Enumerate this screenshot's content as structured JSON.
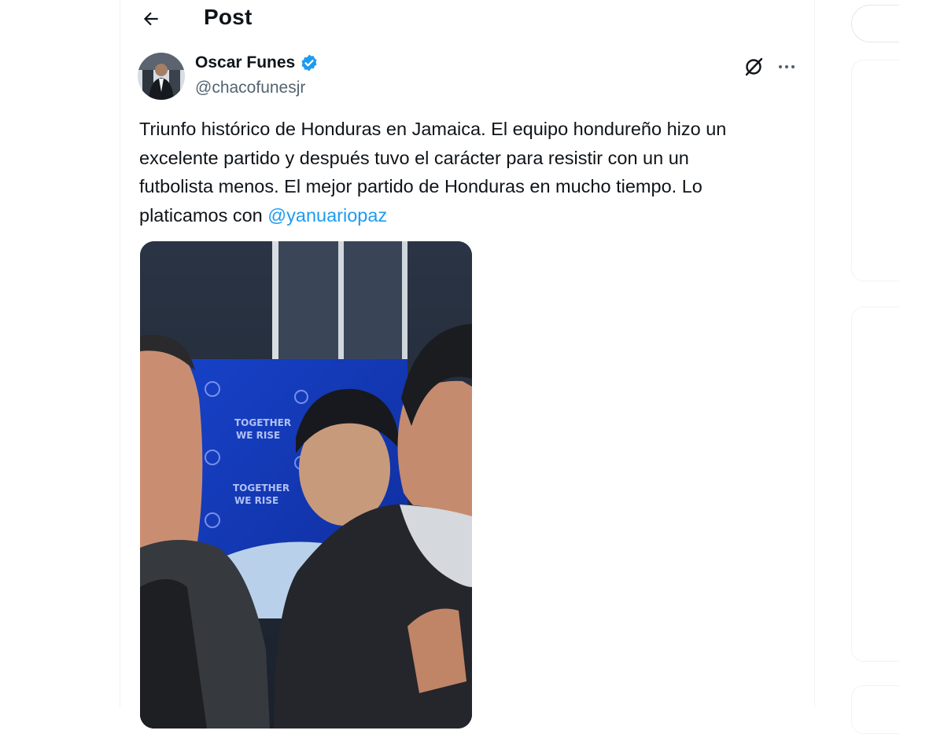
{
  "header": {
    "title": "Post"
  },
  "post": {
    "author_name": "Oscar Funes",
    "handle": "@chacofunesjr",
    "text_lines": [
      "Triunfo histórico de Honduras en Jamaica. El equipo hondureño hizo un",
      "excelente partido y después tuvo el carácter para resistir con un un",
      "futbolista menos. El mejor partido de Honduras en mucho tiempo. Lo",
      "platicamos con "
    ],
    "mention": "@yanuariopaz",
    "backdrop_text": [
      "TOGETHER",
      "WE RISE"
    ]
  },
  "colors": {
    "accent": "#1d9bf0",
    "text_primary": "#0f1419",
    "text_secondary": "#536471",
    "border": "#eff3f4"
  },
  "icons": {
    "back": "arrow-left-icon",
    "verified": "verified-badge-icon",
    "grok": "grok-icon",
    "more": "more-horizontal-icon"
  }
}
